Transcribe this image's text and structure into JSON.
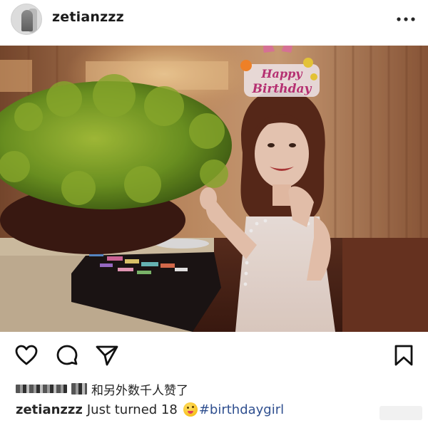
{
  "header": {
    "username": "zetianzzz",
    "more_icon": "more-horizontal-icon"
  },
  "photo": {
    "description_icon": "post-photo",
    "topper_line1": "Happy",
    "topper_line2": "Birthday"
  },
  "actions": {
    "like_icon": "heart-icon",
    "comment_icon": "comment-icon",
    "share_icon": "paper-plane-icon",
    "save_icon": "bookmark-icon"
  },
  "likes": {
    "text": "和另外数千人赞了"
  },
  "caption": {
    "username": "zetianzzz",
    "text": "Just turned 18",
    "emoji_icon": "zany-face-emoji-icon",
    "hashtag": "#birthdaygirl"
  },
  "colors": {
    "text": "#262626",
    "hashtag": "#2f4f8f",
    "background": "#ffffff"
  }
}
